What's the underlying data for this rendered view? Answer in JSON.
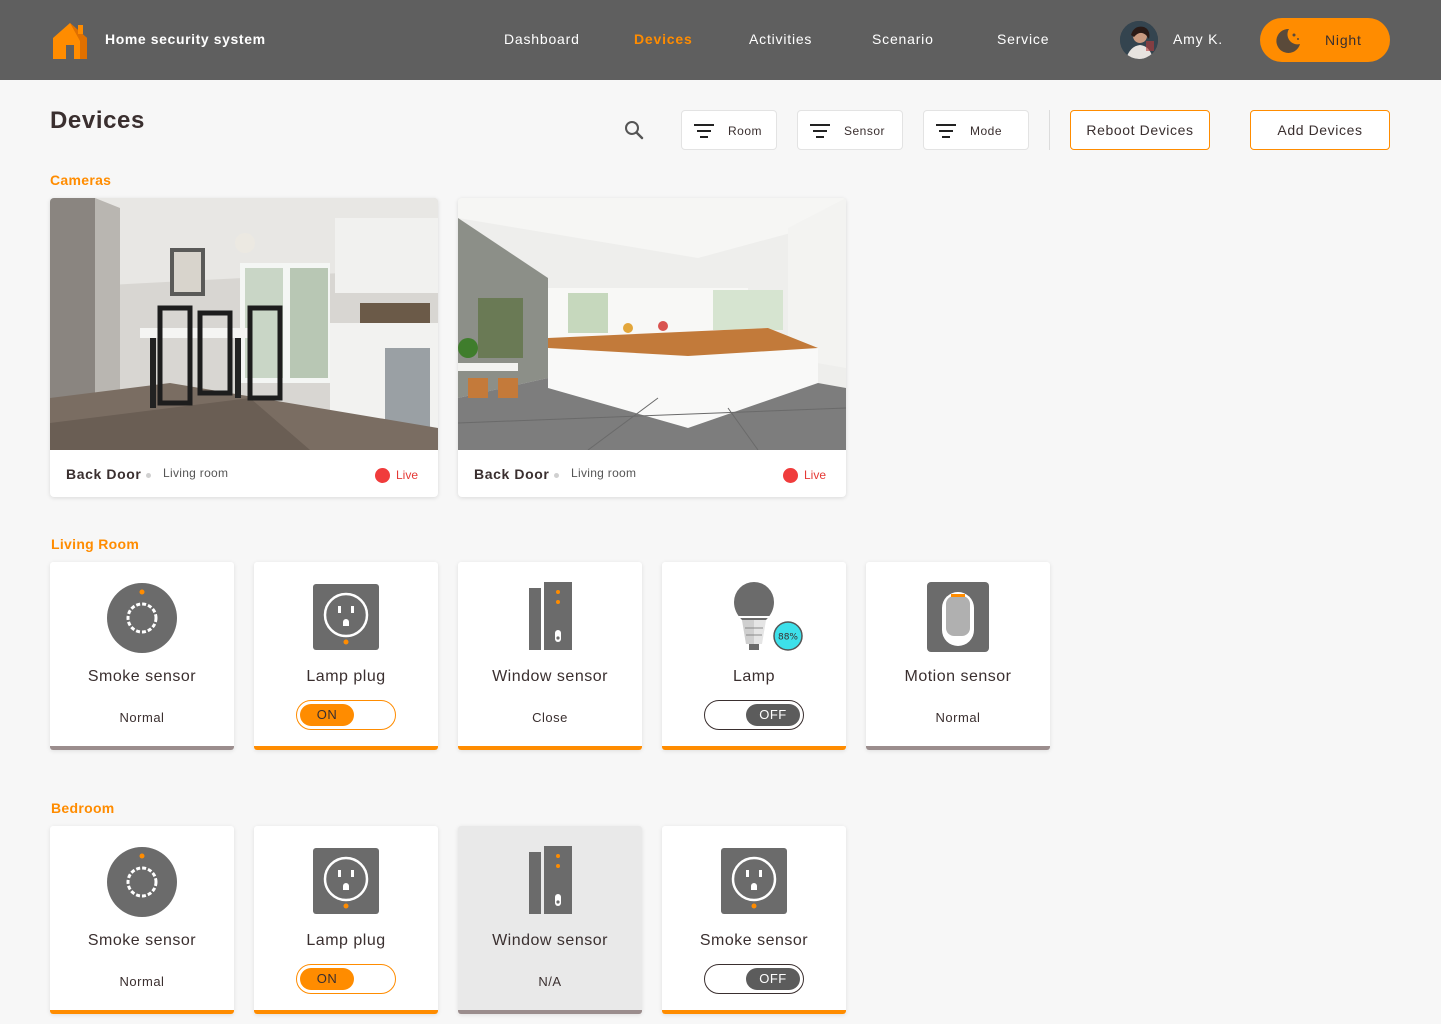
{
  "app": {
    "title": "Home security system"
  },
  "nav": {
    "items": [
      {
        "label": "Dashboard",
        "active": false
      },
      {
        "label": "Devices",
        "active": true
      },
      {
        "label": "Activities",
        "active": false
      },
      {
        "label": "Scenario",
        "active": false
      },
      {
        "label": "Service",
        "active": false
      }
    ]
  },
  "user": {
    "name": "Amy K."
  },
  "mode": {
    "label": "Night",
    "icon": "moon-icon"
  },
  "page": {
    "title": "Devices"
  },
  "filters": [
    {
      "label": "Room",
      "icon": "filter-icon"
    },
    {
      "label": "Sensor",
      "icon": "filter-icon"
    },
    {
      "label": "Mode",
      "icon": "filter-icon"
    }
  ],
  "actions": {
    "reboot_label": "Reboot Devices",
    "add_label": "Add Devices"
  },
  "cameras": {
    "title": "Cameras",
    "items": [
      {
        "name": "Back Door",
        "room": "Living room",
        "status": "Live"
      },
      {
        "name": "Back Door",
        "room": "Living room",
        "status": "Live"
      }
    ]
  },
  "living_room": {
    "title": "Living Room",
    "devices": [
      {
        "name": "Smoke sensor",
        "status": "Normal",
        "icon": "smoke-sensor-icon"
      },
      {
        "name": "Lamp plug",
        "toggle": "ON",
        "icon": "plug-icon"
      },
      {
        "name": "Window sensor",
        "status": "Close",
        "icon": "window-sensor-icon"
      },
      {
        "name": "Lamp",
        "toggle": "OFF",
        "icon": "bulb-icon",
        "brightness": "88%"
      },
      {
        "name": "Motion sensor",
        "status": "Normal",
        "icon": "motion-sensor-icon"
      }
    ]
  },
  "bedroom": {
    "title": "Bedroom",
    "devices": [
      {
        "name": "Smoke sensor",
        "status": "Normal",
        "icon": "smoke-sensor-icon"
      },
      {
        "name": "Lamp plug",
        "toggle": "ON",
        "icon": "plug-icon"
      },
      {
        "name": "Window sensor",
        "status": "N/A",
        "icon": "window-sensor-icon",
        "disabled": true
      },
      {
        "name": "Smoke sensor",
        "toggle": "OFF",
        "icon": "plug-icon"
      }
    ]
  },
  "colors": {
    "accent": "#ff8c00",
    "topbar": "#5f5f5f",
    "live": "#f03c3c",
    "icon_gray": "#6b6b6b"
  }
}
